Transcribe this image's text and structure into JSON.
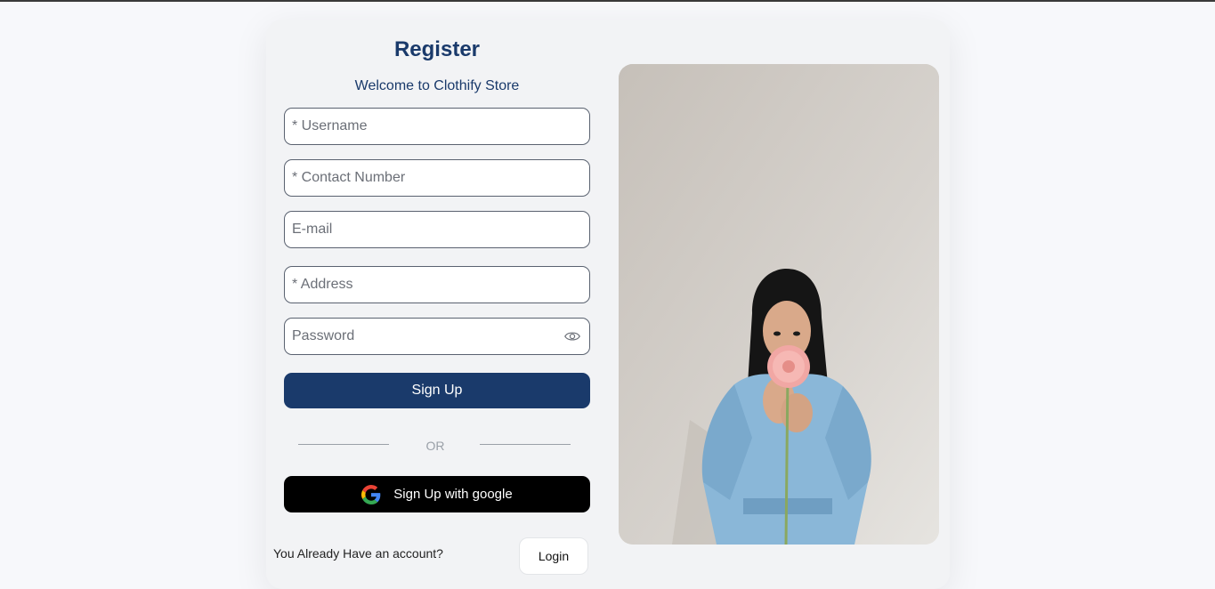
{
  "form": {
    "title": "Register",
    "subtitle": "Welcome to Clothify Store",
    "username_placeholder": "* Username",
    "contact_placeholder": "* Contact Number",
    "email_placeholder": "E-mail",
    "address_placeholder": "* Address",
    "password_placeholder": "Password",
    "signup_label": "Sign Up",
    "or_label": "OR",
    "google_label": "Sign Up with google",
    "account_prompt": "You Already Have an account?",
    "login_label": "Login"
  },
  "icons": {
    "password_toggle": "eye-icon",
    "google": "google-icon"
  },
  "colors": {
    "primary": "#1a3a6b",
    "google_button": "#000000",
    "background": "#f7f8fb",
    "card": "#f2f3f5"
  }
}
